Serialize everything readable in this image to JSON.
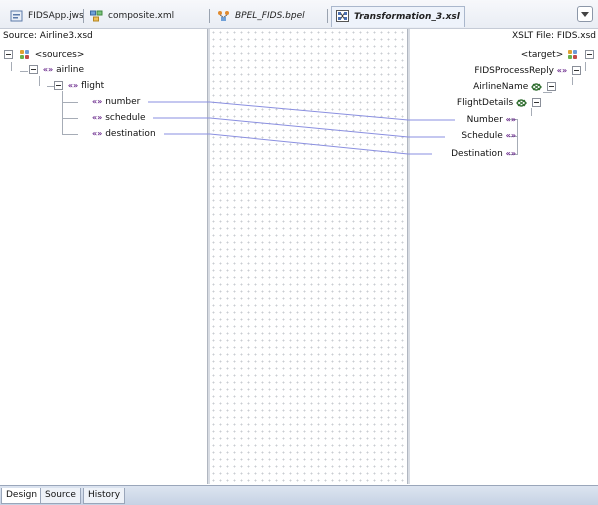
{
  "tabs": [
    {
      "label": "FIDSApp.jws",
      "icon": "workspace-icon"
    },
    {
      "label": "composite.xml",
      "icon": "composite-icon"
    },
    {
      "label": "BPEL_FIDS.bpel",
      "icon": "bpel-icon"
    },
    {
      "label": "Transformation_3.xsl",
      "icon": "xsl-icon",
      "active": true
    }
  ],
  "source": {
    "header": "Source: Airline3.xsd",
    "nodes": {
      "sources": "<sources>",
      "airline": "airline",
      "flight": "flight",
      "number": "number",
      "schedule": "schedule",
      "destination": "destination"
    }
  },
  "target": {
    "header": "XSLT File: FIDS.xsd",
    "nodes": {
      "target": "<target>",
      "fids_process_reply": "FIDSProcessReply",
      "airline_name": "AirlineName",
      "flight_details": "FlightDetails",
      "number": "Number",
      "schedule": "Schedule",
      "destination": "Destination"
    }
  },
  "element_glyph": "«»",
  "mappings": [
    {
      "from": "number",
      "to": "Number"
    },
    {
      "from": "schedule",
      "to": "Schedule"
    },
    {
      "from": "destination",
      "to": "Destination"
    }
  ],
  "bottom_tabs": [
    {
      "label": "Design",
      "active": true
    },
    {
      "label": "Source"
    },
    {
      "label": "History"
    }
  ]
}
